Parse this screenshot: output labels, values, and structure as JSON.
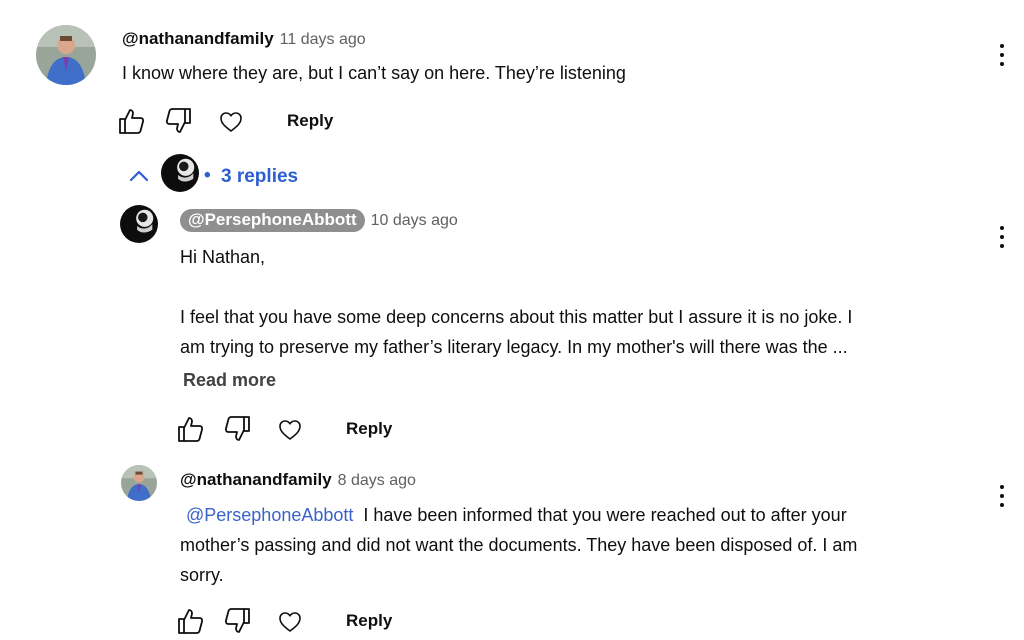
{
  "colors": {
    "link": "#2d5fd1",
    "mention": "#3a63c9",
    "muted": "#606060",
    "chip_bg": "#8f8f8f"
  },
  "comment": {
    "author": "@nathanandfamily",
    "time": "11 days ago",
    "text": "I know where they are, but I can’t say on here. They’re listening",
    "reply_label": "Reply",
    "icons": [
      "thumbs-up-icon",
      "thumbs-down-icon",
      "heart-icon",
      "more-vert-icon"
    ]
  },
  "thread": {
    "toggle_icon": "chevron-up-icon",
    "separator": "•",
    "replies_label": "3 replies"
  },
  "replies": [
    {
      "author": "@PersephoneAbbott",
      "time": "10 days ago",
      "greeting": "Hi Nathan,",
      "line1": "I feel that you have some deep concerns about this matter but I assure it is no joke. I",
      "line2": "am trying to preserve my father’s literary legacy. In my mother's will there was the ...",
      "read_more": "Read more",
      "reply_label": "Reply"
    },
    {
      "author": "@nathanandfamily",
      "time": "8 days ago",
      "mention": "@PersephoneAbbott",
      "line1": "I have been informed that you were reached out to after your",
      "line2": "mother’s passing and did not want the documents. They have been disposed of. I am",
      "line3": "sorry.",
      "reply_label": "Reply"
    }
  ]
}
